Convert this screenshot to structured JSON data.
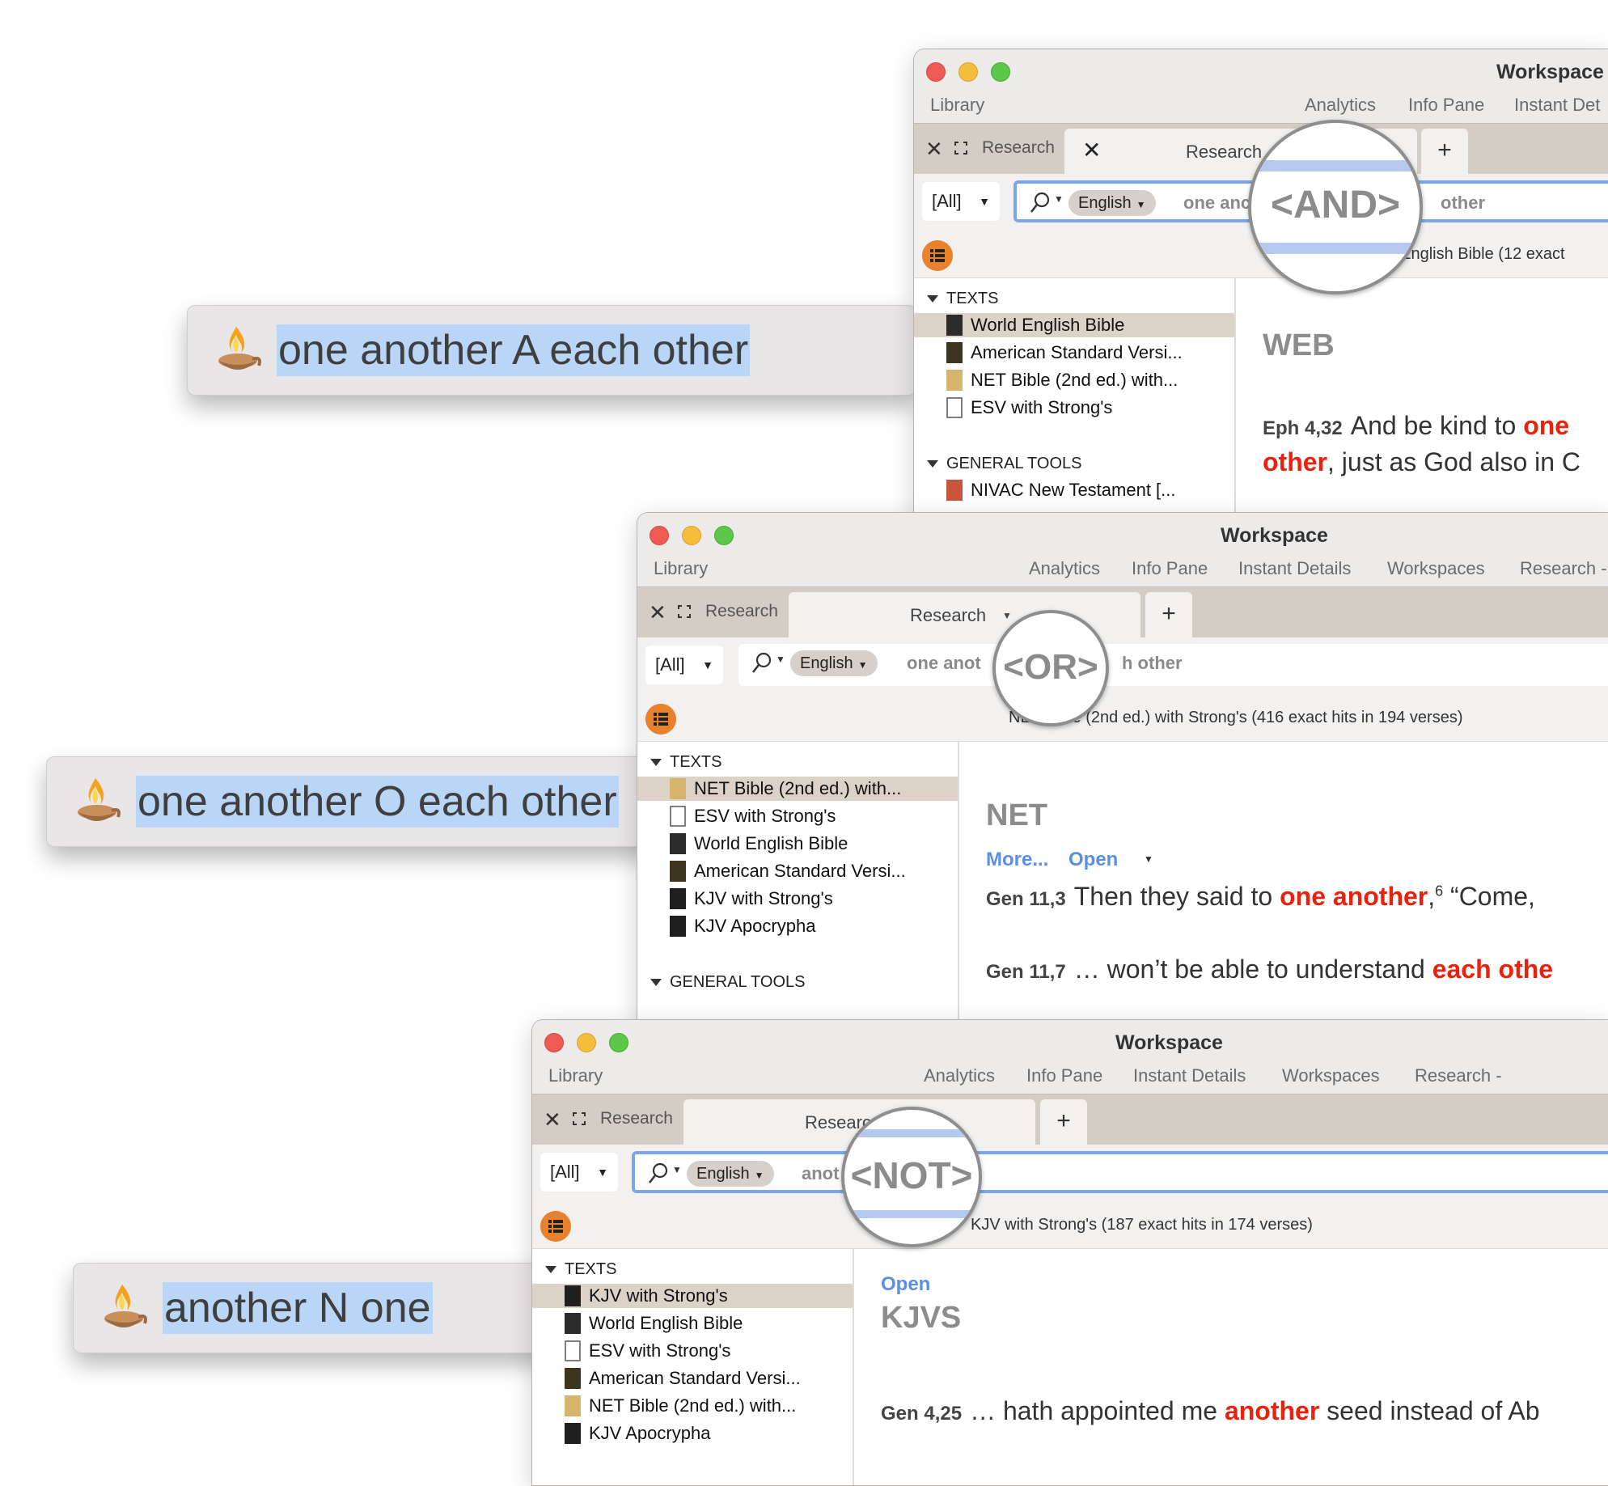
{
  "launchers": [
    {
      "query": "one another A each other"
    },
    {
      "query": "one another O each other"
    },
    {
      "query": "another N one"
    }
  ],
  "windows": [
    {
      "title": "Workspace",
      "menu": [
        "Library",
        "Analytics",
        "Info Pane",
        "Instant Det"
      ],
      "tab_left_label": "Research",
      "tab_active_label": "Research",
      "scope": "[All]",
      "language": "English",
      "query_left": "one anc",
      "query_right": "other",
      "magnifier": "<AND>",
      "status": "ld English Bible (12 exact",
      "sections": [
        "TEXTS",
        "GENERAL TOOLS"
      ],
      "texts": [
        "World English Bible",
        "American Standard Versi...",
        "NET Bible (2nd ed.) with...",
        "ESV with Strong's"
      ],
      "tools": [
        "NIVAC New Testament [..."
      ],
      "abbr": "WEB",
      "verses": [
        {
          "ref": "Eph 4,32",
          "pre": "And be kind to ",
          "hit": "one",
          "post": ""
        },
        {
          "ref": "",
          "pre": "",
          "hit": "other",
          "post": ", just as God also in C"
        }
      ]
    },
    {
      "title": "Workspace",
      "menu": [
        "Library",
        "Analytics",
        "Info Pane",
        "Instant Details",
        "Workspaces",
        "Research -"
      ],
      "tab_left_label": "Research",
      "tab_active_label": "Research",
      "scope": "[All]",
      "language": "English",
      "query_left": "one anot",
      "query_right": "h other",
      "magnifier": "<OR>",
      "status": "NET Bible (2nd ed.) with Strong's (416 exact hits in 194 verses)",
      "sections": [
        "TEXTS",
        "GENERAL TOOLS"
      ],
      "texts": [
        "NET Bible (2nd ed.) with...",
        "ESV with Strong's",
        "World English Bible",
        "American Standard Versi...",
        "KJV with Strong's",
        "KJV Apocrypha"
      ],
      "abbr": "NET",
      "links": [
        "More...",
        "Open"
      ],
      "verses": [
        {
          "ref": "Gen 11,3",
          "pre": "Then they said to ",
          "hit": "one another",
          "post": ",",
          "sup": "6",
          "tail": " “Come,"
        },
        {
          "ref": "Gen 11,7",
          "pre": "… won’t be able to understand ",
          "hit": "each othe",
          "post": ""
        }
      ]
    },
    {
      "title": "Workspace",
      "menu": [
        "Library",
        "Analytics",
        "Info Pane",
        "Instant Details",
        "Workspaces",
        "Research -"
      ],
      "tab_left_label": "Research",
      "tab_active_label": "Researc",
      "scope": "[All]",
      "language": "English",
      "query_left": "anot",
      "query_right": "",
      "magnifier": "<NOT>",
      "status": "KJV with Strong's (187 exact hits in 174 verses)",
      "sections": [
        "TEXTS"
      ],
      "texts": [
        "KJV with Strong's",
        "World English Bible",
        "ESV with Strong's",
        "American Standard Versi...",
        "NET Bible (2nd ed.) with...",
        "KJV Apocrypha"
      ],
      "abbr": "KJVS",
      "links": [
        "Open"
      ],
      "verses": [
        {
          "ref": "Gen 4,25",
          "pre": "… hath appointed me ",
          "hit": "another",
          "post": " seed instead of Ab"
        }
      ]
    }
  ],
  "colors": {
    "highlight": "#e8220d",
    "link": "#5b8ee6",
    "accent_orange": "#e8812b",
    "selection": "#b9d6f7"
  }
}
